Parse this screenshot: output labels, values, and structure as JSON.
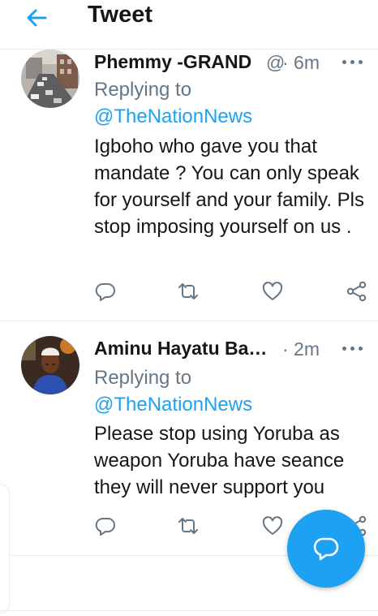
{
  "header": {
    "title": "Tweet",
    "back_icon": "arrow-left-icon"
  },
  "tweets": [
    {
      "display_name": "Phemmy -GRAND",
      "handle": "@",
      "time": "· 6m",
      "replying_to_label": "Replying to",
      "replying_to_handle": "@TheNationNews",
      "text": "Igboho who gave you that mandate ? You can only speak for yourself and your family. Pls stop imposing yourself on us ."
    },
    {
      "display_name": "Aminu Hayatu Ba…",
      "time": "· 2m",
      "replying_to_label": "Replying to",
      "replying_to_handle": "@TheNationNews",
      "text": "Please stop using Yoruba as weapon  Yoruba have seance they will never support you"
    }
  ],
  "colors": {
    "accent": "#1da1f2",
    "secondary_text": "#657786",
    "divider": "#e6ecf0"
  },
  "icons": [
    "reply-icon",
    "retweet-icon",
    "like-icon",
    "share-icon",
    "more-icon",
    "compose-reply-icon"
  ]
}
